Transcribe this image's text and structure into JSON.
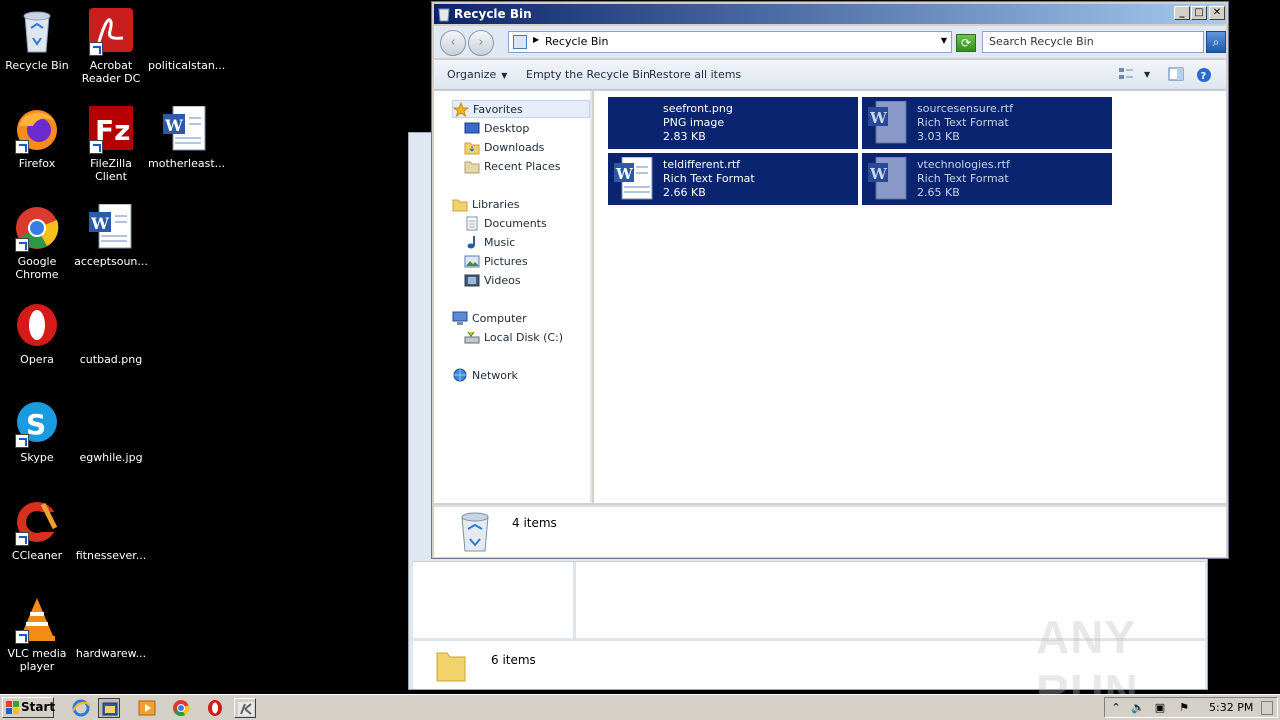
{
  "desktop": {
    "icons": [
      {
        "label": "Recycle Bin"
      },
      {
        "label": "Acrobat Reader DC"
      },
      {
        "label": "politicalstan..."
      },
      {
        "label": "Firefox"
      },
      {
        "label": "FileZilla Client"
      },
      {
        "label": "motherleast..."
      },
      {
        "label": "Google Chrome"
      },
      {
        "label": "acceptsoun..."
      },
      {
        "label": "Opera"
      },
      {
        "label": "cutbad.png"
      },
      {
        "label": "Skype"
      },
      {
        "label": "egwhile.jpg"
      },
      {
        "label": "CCleaner"
      },
      {
        "label": "fitnessever..."
      },
      {
        "label": "VLC media player"
      },
      {
        "label": "hardwarew..."
      }
    ]
  },
  "background_window": {
    "status_count": "6 items"
  },
  "window": {
    "title": "Recycle Bin",
    "address": "Recycle Bin",
    "search_placeholder": "Search Recycle Bin",
    "toolbar": {
      "organize": "Organize",
      "empty": "Empty the Recycle Bin",
      "restore": "Restore all items"
    },
    "nav": {
      "favorites": "Favorites",
      "desktop": "Desktop",
      "downloads": "Downloads",
      "recent": "Recent Places",
      "libraries": "Libraries",
      "documents": "Documents",
      "music": "Music",
      "pictures": "Pictures",
      "videos": "Videos",
      "computer": "Computer",
      "localdisk": "Local Disk (C:)",
      "network": "Network"
    },
    "files": [
      {
        "name": "seefront.png",
        "type": "PNG image",
        "size": "2.83 KB"
      },
      {
        "name": "sourcesensure.rtf",
        "type": "Rich Text Format",
        "size": "3.03 KB"
      },
      {
        "name": "teldifferent.rtf",
        "type": "Rich Text Format",
        "size": "2.66 KB"
      },
      {
        "name": "vtechnologies.rtf",
        "type": "Rich Text Format",
        "size": "2.65 KB"
      }
    ],
    "status_count": "4 items"
  },
  "taskbar": {
    "start": "Start",
    "clock": "5:32 PM"
  },
  "watermark": "ANY RUN",
  "colors": {
    "selection": "#0a2470",
    "titlebar_start": "#0a246a",
    "titlebar_end": "#a6caf0"
  }
}
